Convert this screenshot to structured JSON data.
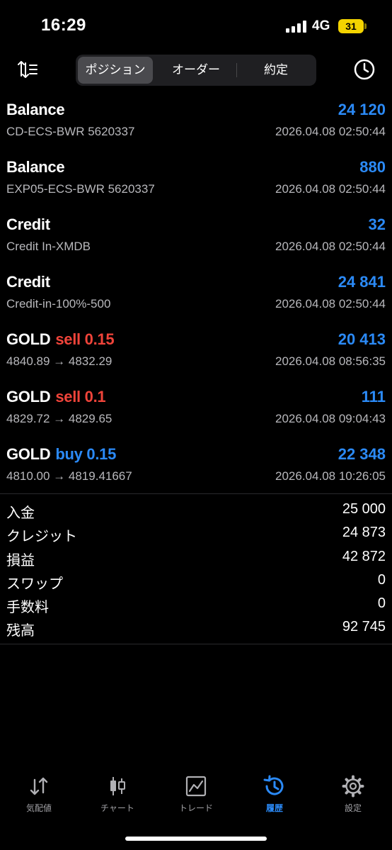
{
  "status": {
    "time": "16:29",
    "network": "4G",
    "battery": "31"
  },
  "toolbar": {
    "segments": [
      {
        "label": "ポジション",
        "active": true
      },
      {
        "label": "オーダー",
        "active": false
      },
      {
        "label": "約定",
        "active": false
      }
    ]
  },
  "transactions": [
    {
      "type": "Balance",
      "side": "",
      "amount": "24 120",
      "desc": "CD-ECS-BWR 5620337",
      "date": "2026.04.08 02:50:44"
    },
    {
      "type": "Balance",
      "side": "",
      "amount": "880",
      "desc": "EXP05-ECS-BWR 5620337",
      "date": "2026.04.08 02:50:44"
    },
    {
      "type": "Credit",
      "side": "",
      "amount": "32",
      "desc": "Credit In-XMDB",
      "date": "2026.04.08 02:50:44"
    },
    {
      "type": "Credit",
      "side": "",
      "amount": "24 841",
      "desc": "Credit-in-100%-500",
      "date": "2026.04.08 02:50:44"
    },
    {
      "type": "GOLD",
      "side": "sell 0.15",
      "side_kind": "sell",
      "amount": "20 413",
      "desc": "4840.89 → 4832.29",
      "date": "2026.04.08 08:56:35"
    },
    {
      "type": "GOLD",
      "side": "sell 0.1",
      "side_kind": "sell",
      "amount": "111",
      "desc": "4829.72 → 4829.65",
      "date": "2026.04.08 09:04:43"
    },
    {
      "type": "GOLD",
      "side": "buy 0.15",
      "side_kind": "buy",
      "amount": "22 348",
      "desc": "4810.00 → 4819.41667",
      "date": "2026.04.08 10:26:05"
    }
  ],
  "summary": [
    {
      "label": "入金",
      "value": "25 000"
    },
    {
      "label": "クレジット",
      "value": "24 873"
    },
    {
      "label": "損益",
      "value": "42 872"
    },
    {
      "label": "スワップ",
      "value": "0"
    },
    {
      "label": "手数料",
      "value": "0"
    },
    {
      "label": "残高",
      "value": "92 745"
    }
  ],
  "tabs": [
    {
      "label": "気配値",
      "icon": "quotes-arrows-icon"
    },
    {
      "label": "チャート",
      "icon": "candlestick-icon"
    },
    {
      "label": "トレード",
      "icon": "trade-chart-icon"
    },
    {
      "label": "履歴",
      "icon": "history-icon",
      "active": true
    },
    {
      "label": "設定",
      "icon": "gear-icon"
    }
  ],
  "colors": {
    "accent": "#2b8af7",
    "sell": "#f0443a",
    "background": "#000000",
    "muted": "#b8b8bc"
  }
}
